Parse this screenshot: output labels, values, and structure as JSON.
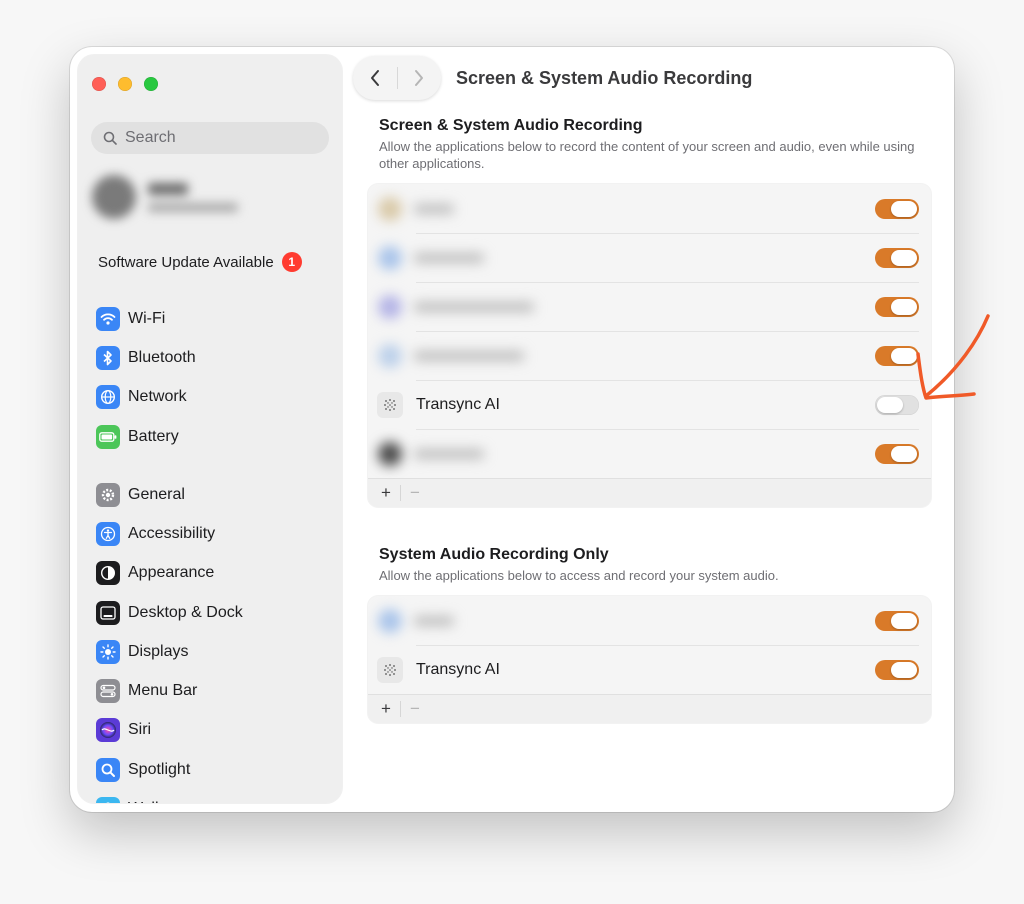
{
  "window": {
    "title": "Screen & System Audio Recording"
  },
  "sidebar": {
    "search_placeholder": "Search",
    "software_update": {
      "label": "Software Update Available",
      "badge": "1"
    },
    "group1": [
      {
        "label": "Wi-Fi",
        "icon": "wifi-icon",
        "color": "#3a86f6"
      },
      {
        "label": "Bluetooth",
        "icon": "bluetooth-icon",
        "color": "#3a86f6"
      },
      {
        "label": "Network",
        "icon": "globe-icon",
        "color": "#3a86f6"
      },
      {
        "label": "Battery",
        "icon": "battery-icon",
        "color": "#4cc659"
      }
    ],
    "group2": [
      {
        "label": "General",
        "icon": "gear-icon",
        "color": "#8e8e93"
      },
      {
        "label": "Accessibility",
        "icon": "accessibility-icon",
        "color": "#3a86f6"
      },
      {
        "label": "Appearance",
        "icon": "appearance-icon",
        "color": "#1c1c1e"
      },
      {
        "label": "Desktop & Dock",
        "icon": "desktop-dock-icon",
        "color": "#1c1c1e"
      },
      {
        "label": "Displays",
        "icon": "sun-icon",
        "color": "#3a86f6"
      },
      {
        "label": "Menu Bar",
        "icon": "menu-bar-icon",
        "color": "#8e8e93"
      },
      {
        "label": "Siri",
        "icon": "siri-icon",
        "color": "#5b3bd6"
      },
      {
        "label": "Spotlight",
        "icon": "magnifier-icon",
        "color": "#3a86f6"
      },
      {
        "label": "Wallpaper",
        "icon": "flower-icon",
        "color": "#3bb7f0"
      }
    ]
  },
  "section1": {
    "title": "Screen & System Audio Recording",
    "description": "Allow the applications below to record the content of your screen and audio, even while using other applications.",
    "apps": [
      {
        "name": "",
        "blurred": true,
        "enabled": true,
        "icon_color": "#d9c9a8"
      },
      {
        "name": "",
        "blurred": true,
        "enabled": true,
        "icon_color": "#a9c4ea"
      },
      {
        "name": "",
        "blurred": true,
        "enabled": true,
        "icon_color": "#b4b4e6"
      },
      {
        "name": "",
        "blurred": true,
        "enabled": true,
        "icon_color": "#bcd0ea"
      },
      {
        "name": "Transync AI",
        "blurred": false,
        "enabled": false,
        "icon_color": "#e8e8e8"
      },
      {
        "name": "",
        "blurred": true,
        "enabled": true,
        "icon_color": "#4a4a4a"
      }
    ],
    "footer": {
      "add": "+",
      "remove": "−"
    }
  },
  "section2": {
    "title": "System Audio Recording Only",
    "description": "Allow the applications below to access and record your system audio.",
    "apps": [
      {
        "name": "",
        "blurred": true,
        "enabled": true,
        "icon_color": "#a9c4ea"
      },
      {
        "name": "Transync AI",
        "blurred": false,
        "enabled": true,
        "icon_color": "#e8e8e8"
      }
    ],
    "footer": {
      "add": "+",
      "remove": "−"
    }
  },
  "colors": {
    "toggle_on": "#d97a29",
    "toggle_off": "#e1e1e1",
    "annotation_arrow": "#f05a28",
    "badge": "#ff3b30"
  }
}
